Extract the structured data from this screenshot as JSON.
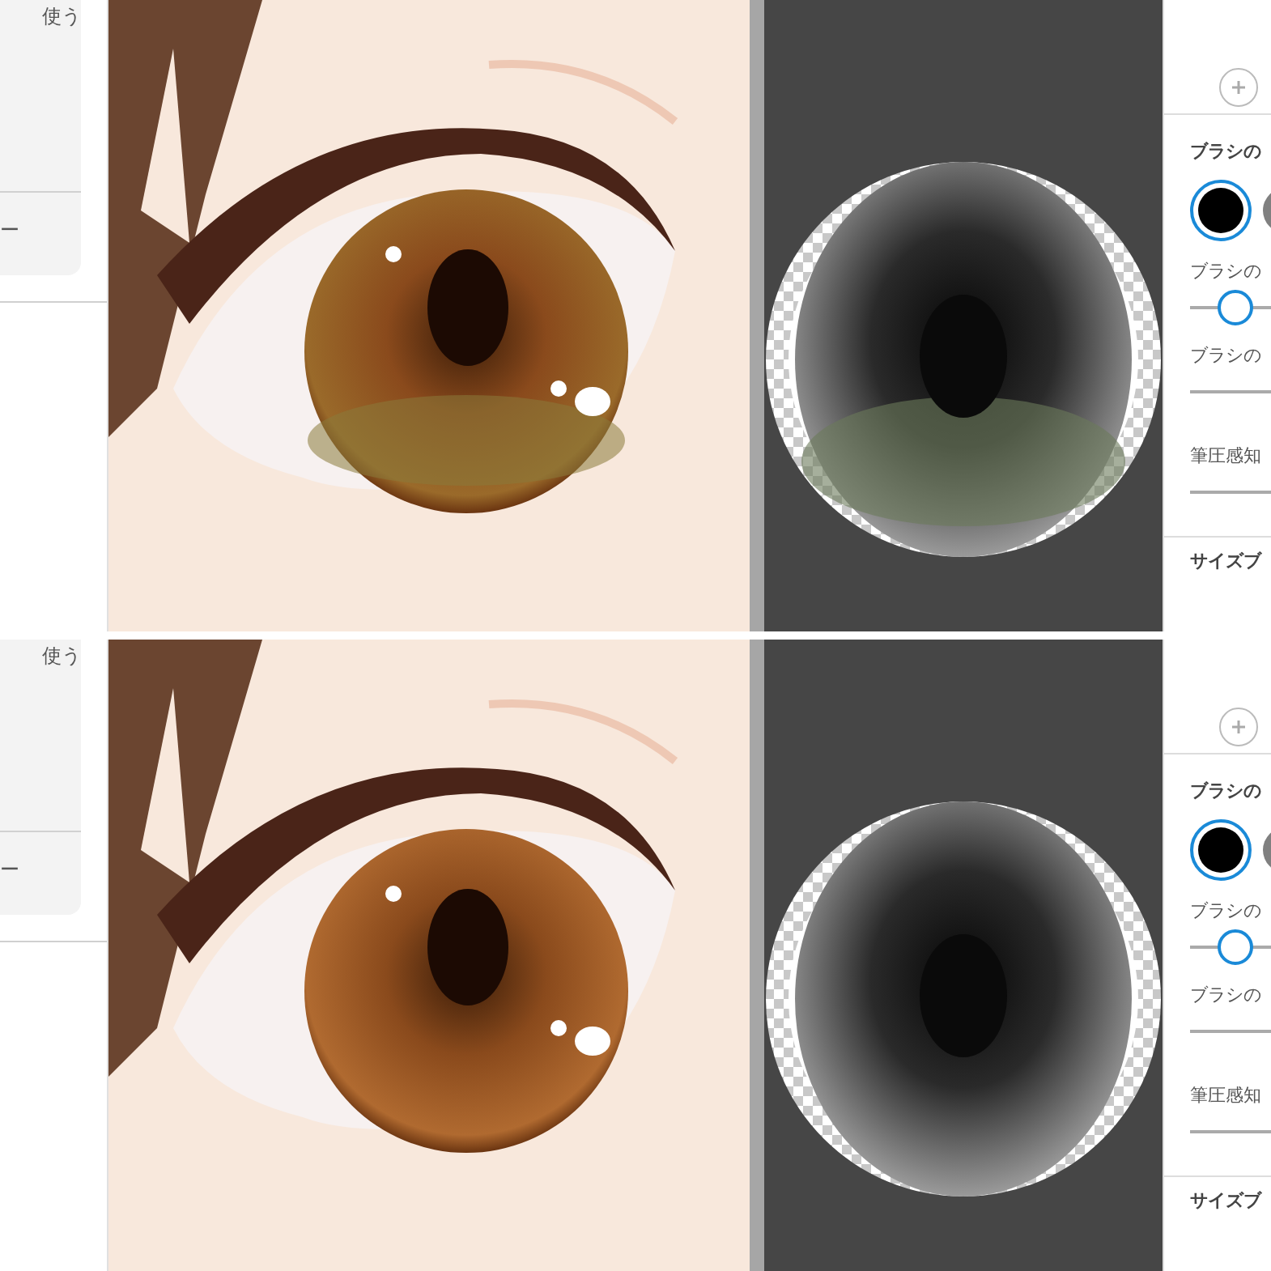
{
  "panes": [
    {
      "kind": "tinted",
      "sidebar": {
        "text_1": "使う",
        "text_2": "ー"
      },
      "tool_panel": {
        "brush_label": "ブラシの",
        "brush_colors": [
          {
            "color": "#000000",
            "selected": true
          },
          {
            "color": "#808080",
            "selected": false
          }
        ],
        "size_label": "ブラシの",
        "size_slider": {
          "level": 0.14
        },
        "opacity_label": "ブラシの",
        "pressure_label": "筆圧感知",
        "section_label": "サイズブ"
      }
    },
    {
      "kind": "plain",
      "sidebar": {
        "text_1": "使う",
        "text_2": "ー"
      },
      "tool_panel": {
        "brush_label": "ブラシの",
        "brush_colors": [
          {
            "color": "#000000",
            "selected": true
          },
          {
            "color": "#808080",
            "selected": false
          }
        ],
        "size_label": "ブラシの",
        "size_slider": {
          "level": 0.14
        },
        "opacity_label": "ブラシの",
        "pressure_label": "筆圧感知",
        "section_label": "サイズブ"
      }
    }
  ]
}
